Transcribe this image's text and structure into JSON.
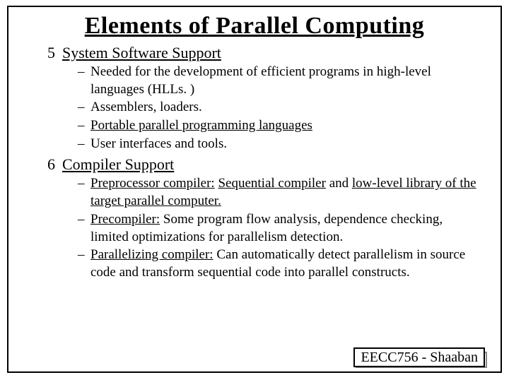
{
  "title": "Elements of Parallel Computing",
  "sections": [
    {
      "num": "5",
      "label": "System Software Support",
      "items": [
        {
          "plain_before": "Needed for the development of efficient programs in high-level languages (HLLs. )"
        },
        {
          "plain_before": "Assemblers, loaders."
        },
        {
          "u1": "Portable parallel programming languages"
        },
        {
          "plain_before": "User interfaces and tools."
        }
      ]
    },
    {
      "num": "6",
      "label": "Compiler Support",
      "items": [
        {
          "u1": "Preprocessor compiler:",
          "mid1": "  ",
          "u2": "Sequential compiler",
          "mid2": " and ",
          "u3": "low-level library of the target parallel computer."
        },
        {
          "u1": "Precompiler:",
          "mid1": "  Some program flow analysis, dependence checking, limited optimizations for parallelism detection."
        },
        {
          "u1": "Parallelizing compiler:",
          "mid1": "  Can automatically detect parallelism in source code and transform sequential code into parallel constructs."
        }
      ]
    }
  ],
  "footer": "EECC756 - Shaaban"
}
